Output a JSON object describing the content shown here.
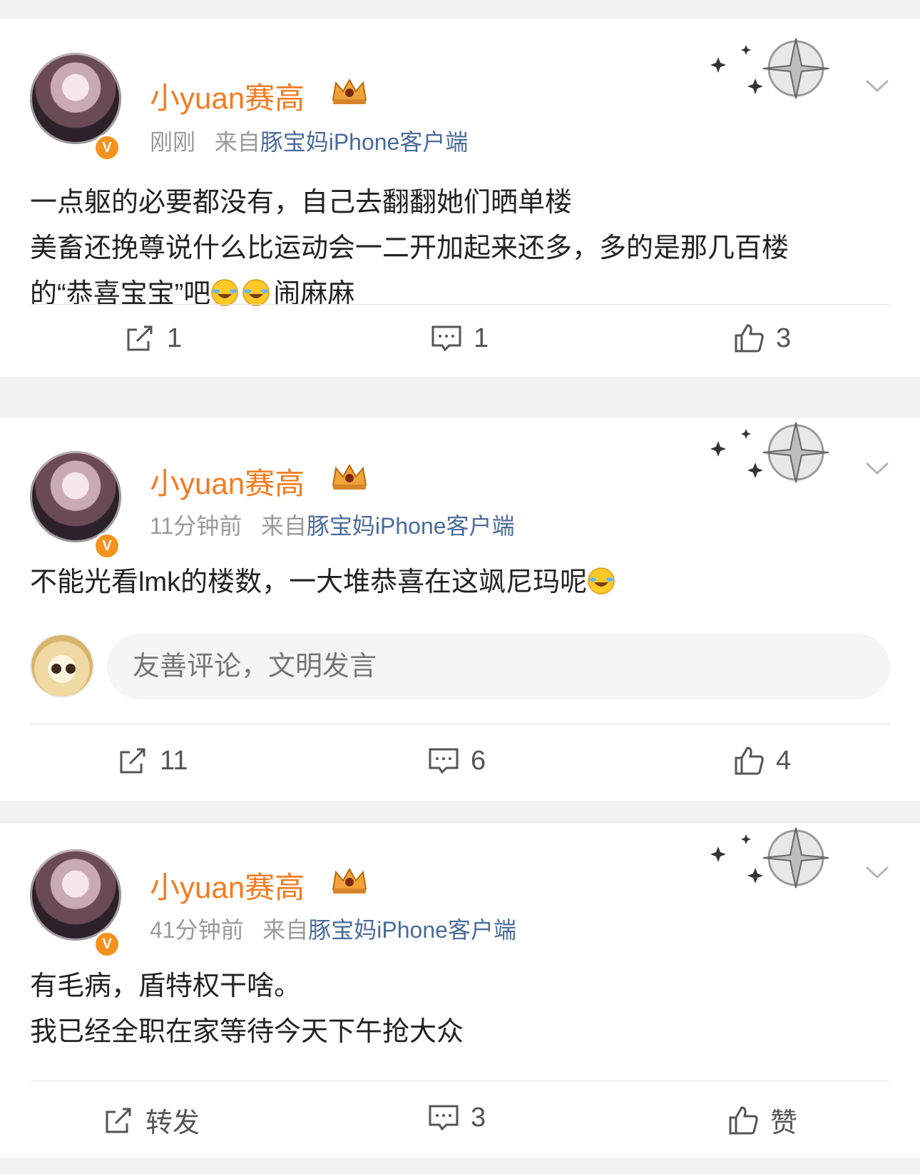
{
  "posts": [
    {
      "username": "小yuan赛高",
      "time": "刚刚",
      "source_prefix": "来自",
      "source": "豚宝妈iPhone客户端",
      "lines": [
        "一点躯的必要都没有，自己去翻翻她们晒单楼",
        "美畜还挽尊说什么比运动会一二开加起来还多，多的是那几百楼",
        "的“恭喜宝宝”吧",
        "闹麻麻"
      ],
      "repost": "1",
      "comment": "1",
      "like": "3"
    },
    {
      "username": "小yuan赛高",
      "time": "11分钟前",
      "source_prefix": "来自",
      "source": "豚宝妈iPhone客户端",
      "lines": [
        "不能光看lmk的楼数，一大堆恭喜在这飒尼玛呢"
      ],
      "comment_placeholder": "友善评论，文明发言",
      "repost": "11",
      "comment": "6",
      "like": "4"
    },
    {
      "username": "小yuan赛高",
      "time": "41分钟前",
      "source_prefix": "来自",
      "source": "豚宝妈iPhone客户端",
      "lines": [
        "有毛病，盾特权干啥。",
        "我已经全职在家等待今天下午抢大众"
      ],
      "repost": "转发",
      "comment": "3",
      "like": "赞"
    }
  ],
  "verified_badge": "V",
  "colors": {
    "username": "#f47b20",
    "source_link": "#4a6b9a",
    "badge": "#f5921d"
  },
  "icons": [
    "repost-icon",
    "comment-icon",
    "like-icon",
    "chevron-down-icon",
    "crown-icon",
    "verified-icon",
    "emoji-cry-laugh-icon"
  ]
}
